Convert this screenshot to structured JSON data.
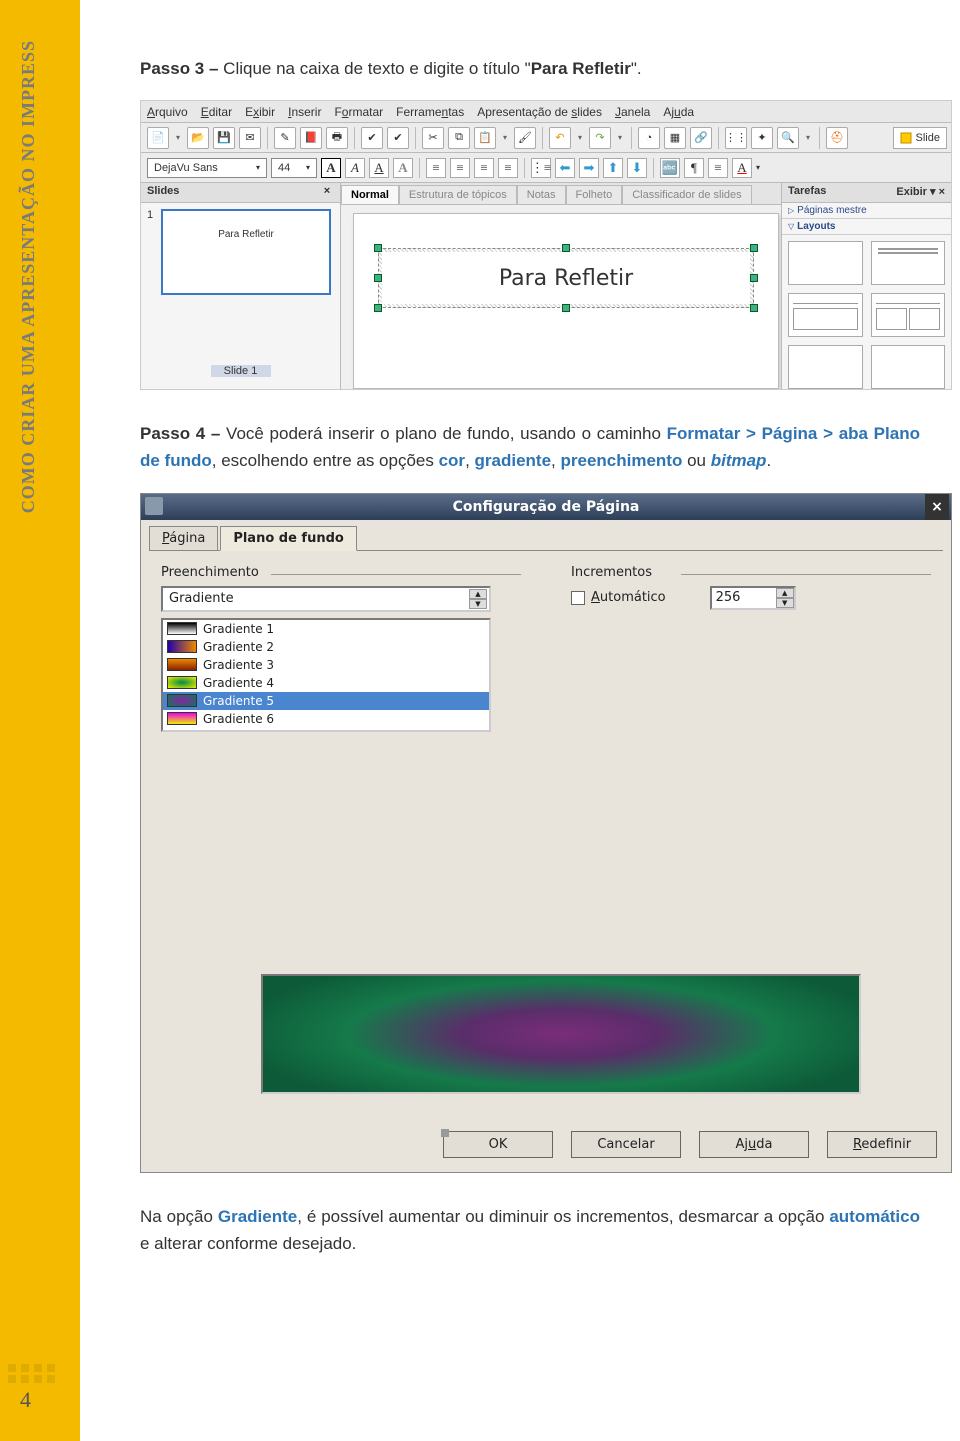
{
  "sidebar": {
    "text": "COMO CRIAR UMA APRESENTAÇÃO NO IMPRESS",
    "page_number": "4"
  },
  "step3": {
    "prefix": "Passo 3 –",
    "text": " Clique na caixa de texto e digite o título \"",
    "title": "Para Refletir",
    "suffix": "\"."
  },
  "impress": {
    "menu": [
      "Arquivo",
      "Editar",
      "Exibir",
      "Inserir",
      "Formatar",
      "Ferramentas",
      "Apresentação de slides",
      "Janela",
      "Ajuda"
    ],
    "slide_btn": "Slide",
    "font_name": "DejaVu Sans",
    "font_size": "44",
    "slides_panel": {
      "title": "Slides",
      "num": "1",
      "thumb_text": "Para Refletir",
      "slide_label": "Slide 1"
    },
    "center_tabs": [
      "Normal",
      "Estrutura de tópicos",
      "Notas",
      "Folheto",
      "Classificador de slides"
    ],
    "canvas_text": "Para Refletir",
    "tasks": {
      "title": "Tarefas",
      "exibir": "Exibir",
      "sub1": "Páginas mestre",
      "sub2": "Layouts"
    }
  },
  "step4": {
    "prefix": "Passo 4 –",
    "t1": " Você poderá inserir o plano de fundo, usando o caminho ",
    "b1": "Formatar > Página > ",
    "t2": "aba ",
    "b2": "Plano de fundo",
    "t3": ", escolhendo entre as opções ",
    "b3": "cor",
    "t4": ", ",
    "b4": "gradiente",
    "t5": ", ",
    "b5": "preenchimento",
    "t6": " ou ",
    "b6": "bitmap",
    "t7": "."
  },
  "dialog": {
    "title": "Configuração de Página",
    "tabs": [
      "Página",
      "Plano de fundo"
    ],
    "preenchimento": "Preenchimento",
    "incrementos": "Incrementos",
    "combo_value": "Gradiente",
    "automatico": "Automático",
    "num_value": "256",
    "gradients": [
      "Gradiente 1",
      "Gradiente 2",
      "Gradiente 3",
      "Gradiente 4",
      "Gradiente 5",
      "Gradiente 6"
    ],
    "buttons": {
      "ok": "OK",
      "cancel": "Cancelar",
      "help": "Ajuda",
      "reset": "Redefinir"
    }
  },
  "bottom": {
    "t1": "Na opção ",
    "b1": "Gradiente",
    "t2": ", é possível aumentar ou diminuir os incrementos, desmarcar a opção ",
    "b2": "automático",
    "t3": " e alterar conforme desejado."
  }
}
